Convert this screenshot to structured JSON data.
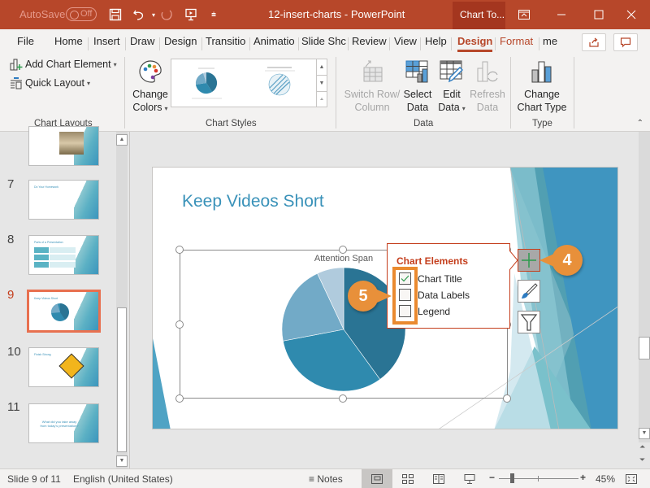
{
  "titlebar": {
    "autosave_label": "AutoSave",
    "autosave_state": "Off",
    "document_title": "12-insert-charts  -  PowerPoint",
    "contextual_tab": "Chart To...",
    "icons": [
      "save-icon",
      "undo-icon",
      "redo-icon",
      "present-icon",
      "customize-qat-icon",
      "ribbon-display-icon",
      "minimize-icon",
      "maximize-icon",
      "close-icon"
    ]
  },
  "tabs": {
    "items": [
      {
        "label": "File"
      },
      {
        "label": "Home"
      },
      {
        "label": "Insert"
      },
      {
        "label": "Draw"
      },
      {
        "label": "Design"
      },
      {
        "label": "Transitio"
      },
      {
        "label": "Animatio"
      },
      {
        "label": "Slide Shc"
      },
      {
        "label": "Review"
      },
      {
        "label": "View"
      },
      {
        "label": "Help"
      },
      {
        "label": "Design"
      },
      {
        "label": "Format"
      },
      {
        "label": "me"
      }
    ],
    "active_index": 11
  },
  "ribbon": {
    "chart_layouts": {
      "add_chart_element": "Add Chart Element",
      "quick_layout": "Quick Layout",
      "group_label": "Chart Layouts"
    },
    "chart_styles": {
      "change_colors_line1": "Change",
      "change_colors_line2": "Colors",
      "group_label": "Chart Styles"
    },
    "data": {
      "switch_row_line1": "Switch Row/",
      "switch_row_line2": "Column",
      "select_data_line1": "Select",
      "select_data_line2": "Data",
      "edit_data_line1": "Edit",
      "edit_data_line2": "Data",
      "refresh_data_line1": "Refresh",
      "refresh_data_line2": "Data",
      "group_label": "Data"
    },
    "type": {
      "change_type_line1": "Change",
      "change_type_line2": "Chart Type",
      "group_label": "Type"
    }
  },
  "slides_pane": {
    "thumbnails": [
      {
        "number": "",
        "title": ""
      },
      {
        "number": "7",
        "title": "Do Your Homework"
      },
      {
        "number": "8",
        "title": "Parts of a Presentation"
      },
      {
        "number": "9",
        "title": "Keep Videos Short"
      },
      {
        "number": "10",
        "title": "Finish Strong"
      },
      {
        "number": "11",
        "title": "What did you take away from today's presentation?"
      }
    ],
    "active_number": "9"
  },
  "slide": {
    "title": "Keep Videos Short",
    "chart_title": "Attention Span"
  },
  "chart_data": {
    "type": "pie",
    "title": "Attention Span",
    "categories": [],
    "values": [],
    "approximate_share_pct": [
      40,
      32,
      21,
      7
    ],
    "note": "No data labels or legend visible; shares estimated from slice angles, clockwise from 12 o'clock",
    "colors": [
      "#2a7494",
      "#2f8aae",
      "#72aac7",
      "#b0cbdd"
    ],
    "legend": "none",
    "data_labels": false
  },
  "chart_elements_popup": {
    "heading": "Chart Elements",
    "items": [
      {
        "label": "Chart Title",
        "checked": true
      },
      {
        "label": "Data Labels",
        "checked": false
      },
      {
        "label": "Legend",
        "checked": false
      }
    ]
  },
  "side_buttons": [
    "chart-elements-plus-icon",
    "chart-styles-brush-icon",
    "chart-filters-funnel-icon"
  ],
  "callouts": [
    {
      "number": "4"
    },
    {
      "number": "5"
    }
  ],
  "status": {
    "slide_info": "Slide 9 of 11",
    "language": "English (United States)",
    "notes_label": "Notes",
    "zoom_percent": "45%",
    "zoom_level": 0.45
  },
  "colors": {
    "accent": "#b7472a",
    "callout": "#e8903a",
    "title_blue": "#3a92b9"
  }
}
